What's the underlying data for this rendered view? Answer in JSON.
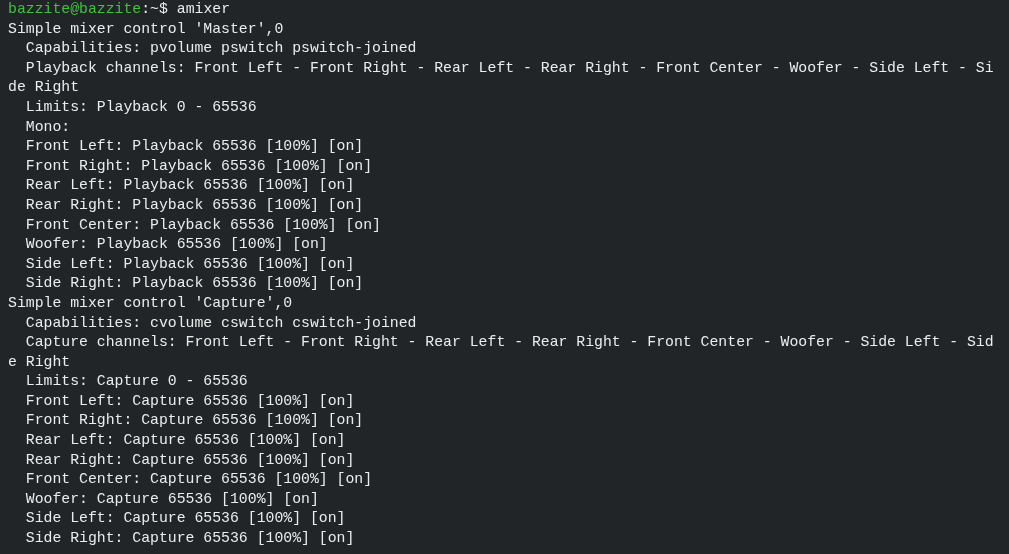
{
  "terminal": {
    "prompt": {
      "user_host": "bazzite@bazzite",
      "path": ":~$",
      "command": "amixer"
    },
    "lines": [
      "Simple mixer control 'Master',0",
      "  Capabilities: pvolume pswitch pswitch-joined",
      "  Playback channels: Front Left - Front Right - Rear Left - Rear Right - Front Center - Woofer - Side Left - Si",
      "de Right",
      "  Limits: Playback 0 - 65536",
      "  Mono:",
      "  Front Left: Playback 65536 [100%] [on]",
      "  Front Right: Playback 65536 [100%] [on]",
      "  Rear Left: Playback 65536 [100%] [on]",
      "  Rear Right: Playback 65536 [100%] [on]",
      "  Front Center: Playback 65536 [100%] [on]",
      "  Woofer: Playback 65536 [100%] [on]",
      "  Side Left: Playback 65536 [100%] [on]",
      "  Side Right: Playback 65536 [100%] [on]",
      "Simple mixer control 'Capture',0",
      "  Capabilities: cvolume cswitch cswitch-joined",
      "  Capture channels: Front Left - Front Right - Rear Left - Rear Right - Front Center - Woofer - Side Left - Sid",
      "e Right",
      "  Limits: Capture 0 - 65536",
      "  Front Left: Capture 65536 [100%] [on]",
      "  Front Right: Capture 65536 [100%] [on]",
      "  Rear Left: Capture 65536 [100%] [on]",
      "  Rear Right: Capture 65536 [100%] [on]",
      "  Front Center: Capture 65536 [100%] [on]",
      "  Woofer: Capture 65536 [100%] [on]",
      "  Side Left: Capture 65536 [100%] [on]",
      "  Side Right: Capture 65536 [100%] [on]"
    ]
  }
}
